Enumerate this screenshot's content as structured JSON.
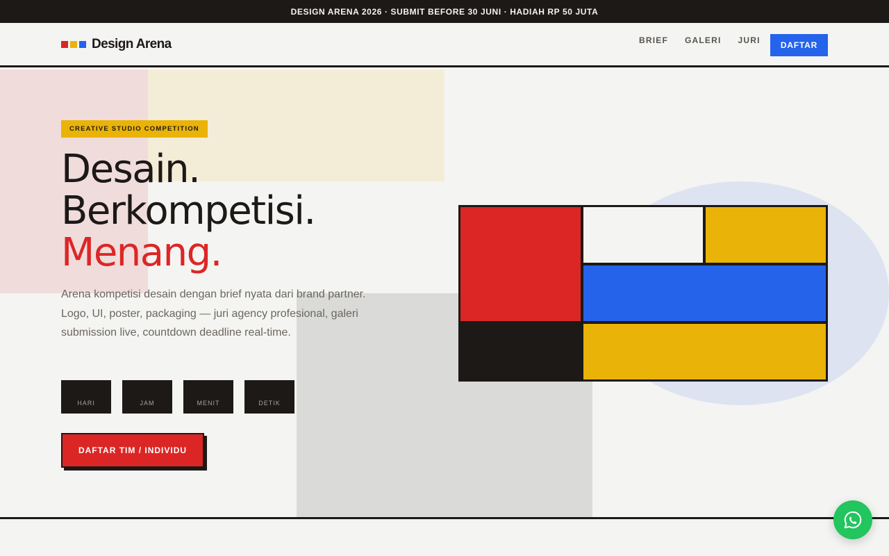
{
  "announcement": "DESIGN ARENA 2026 · SUBMIT BEFORE 30 JUNI · HADIAH RP 50 JUTA",
  "header": {
    "brand": "Design Arena",
    "nav": [
      "BRIEF",
      "GALERI",
      "JURI"
    ],
    "cta": "DAFTAR"
  },
  "hero": {
    "tag": "CREATIVE STUDIO COMPETITION",
    "headline": [
      "Desain.",
      "Berkompetisi.",
      "Menang."
    ],
    "description": "Arena kompetisi desain dengan brief nyata dari brand partner. Logo, UI, poster, packaging — juri agency profesional, galeri submission live, countdown deadline real-time.",
    "countdown": [
      {
        "label": "HARI",
        "value": ""
      },
      {
        "label": "JAM",
        "value": ""
      },
      {
        "label": "MENIT",
        "value": ""
      },
      {
        "label": "DETIK",
        "value": ""
      }
    ],
    "cta": "DAFTAR TIM / INDIVIDU"
  },
  "colors": {
    "dark": "#1c1917",
    "red": "#dc2626",
    "yellow": "#eab308",
    "blue": "#2563eb",
    "green": "#22c55e",
    "background": "#f4f4f2"
  },
  "icons": {
    "floating_button": "whatsapp-icon"
  }
}
